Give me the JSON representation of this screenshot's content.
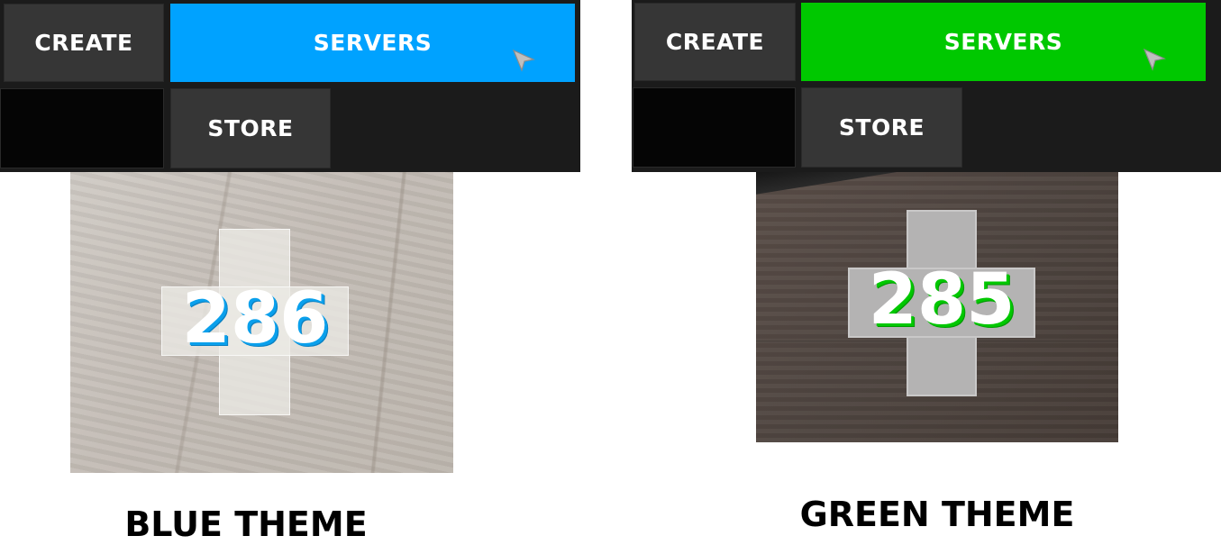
{
  "themes": [
    {
      "id": "blue",
      "caption": "BLUE THEME",
      "accent_color": "#00a2ff",
      "menu": {
        "create_label": "CREATE",
        "servers_label": "SERVERS",
        "store_label": "STORE"
      },
      "counter": "286",
      "cross_icon": "plus-cross-icon",
      "cursor_icon": "arrow-cursor-icon"
    },
    {
      "id": "green",
      "caption": "GREEN THEME",
      "accent_color": "#00c800",
      "menu": {
        "create_label": "CREATE",
        "servers_label": "SERVERS",
        "store_label": "STORE"
      },
      "counter": "285",
      "cross_icon": "plus-cross-icon",
      "cursor_icon": "arrow-cursor-icon"
    }
  ]
}
